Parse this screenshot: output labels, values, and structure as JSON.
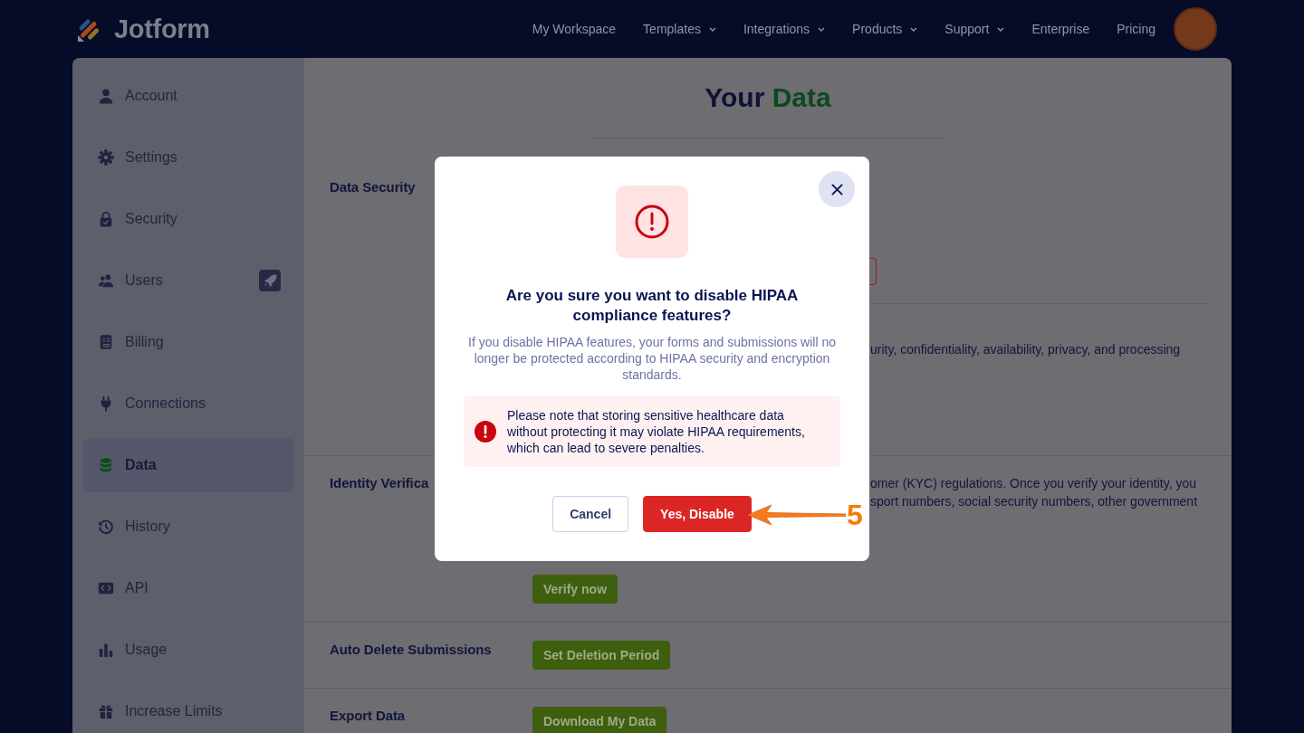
{
  "nav": {
    "brand": "Jotform",
    "links": [
      {
        "label": "My Workspace",
        "dropdown": false
      },
      {
        "label": "Templates",
        "dropdown": true
      },
      {
        "label": "Integrations",
        "dropdown": true
      },
      {
        "label": "Products",
        "dropdown": true
      },
      {
        "label": "Support",
        "dropdown": true
      },
      {
        "label": "Enterprise",
        "dropdown": false
      },
      {
        "label": "Pricing",
        "dropdown": false
      }
    ]
  },
  "sidebar": {
    "items": [
      {
        "label": "Account",
        "selected": false,
        "badge": false
      },
      {
        "label": "Settings",
        "selected": false,
        "badge": false
      },
      {
        "label": "Security",
        "selected": false,
        "badge": false
      },
      {
        "label": "Users",
        "selected": false,
        "badge": true
      },
      {
        "label": "Billing",
        "selected": false,
        "badge": false
      },
      {
        "label": "Connections",
        "selected": false,
        "badge": false
      },
      {
        "label": "Data",
        "selected": true,
        "badge": false
      },
      {
        "label": "History",
        "selected": false,
        "badge": false
      },
      {
        "label": "API",
        "selected": false,
        "badge": false
      },
      {
        "label": "Usage",
        "selected": false,
        "badge": false
      },
      {
        "label": "Increase Limits",
        "selected": false,
        "badge": false
      }
    ]
  },
  "page": {
    "title": "Your",
    "title_highlight": "Data",
    "sections": [
      {
        "label": "Data Security",
        "groups": [
          {
            "parts": [
              {
                "kind": "outlined_button_edge"
              }
            ]
          },
          {
            "parts": [
              {
                "kind": "text",
                "lines": [
                  "urity, confidentiality, availability, privacy, and processing"
                ]
              }
            ]
          }
        ]
      },
      {
        "label": "Identity Verifica",
        "groups": [
          {
            "parts": [
              {
                "kind": "text",
                "lines": [
                  "omer (KYC) regulations. Once you verify your identity, you",
                  "sport numbers, social security numbers, other government"
                ]
              },
              {
                "kind": "button",
                "label": "Verify now"
              }
            ]
          }
        ]
      },
      {
        "label": "Auto Delete Submissions",
        "groups": [
          {
            "parts": [
              {
                "kind": "button",
                "label": "Set Deletion Period"
              }
            ]
          }
        ]
      },
      {
        "label": "Export Data",
        "groups": [
          {
            "parts": [
              {
                "kind": "button",
                "label": "Download My Data"
              }
            ]
          }
        ]
      }
    ]
  },
  "dialog": {
    "title": "Are you sure you want to disable HIPAA compliance features?",
    "message": "If you disable HIPAA features, your forms and submissions will no longer be protected according to HIPAA security and encryption standards.",
    "warning": "Please note that storing sensitive healthcare data without protecting it may violate HIPAA requirements, which can lead to severe penalties.",
    "buttons": [
      {
        "label": "Cancel",
        "kind": "secondary"
      },
      {
        "label": "Yes, Disable",
        "kind": "danger"
      }
    ]
  },
  "annotation": {
    "label": "5"
  }
}
